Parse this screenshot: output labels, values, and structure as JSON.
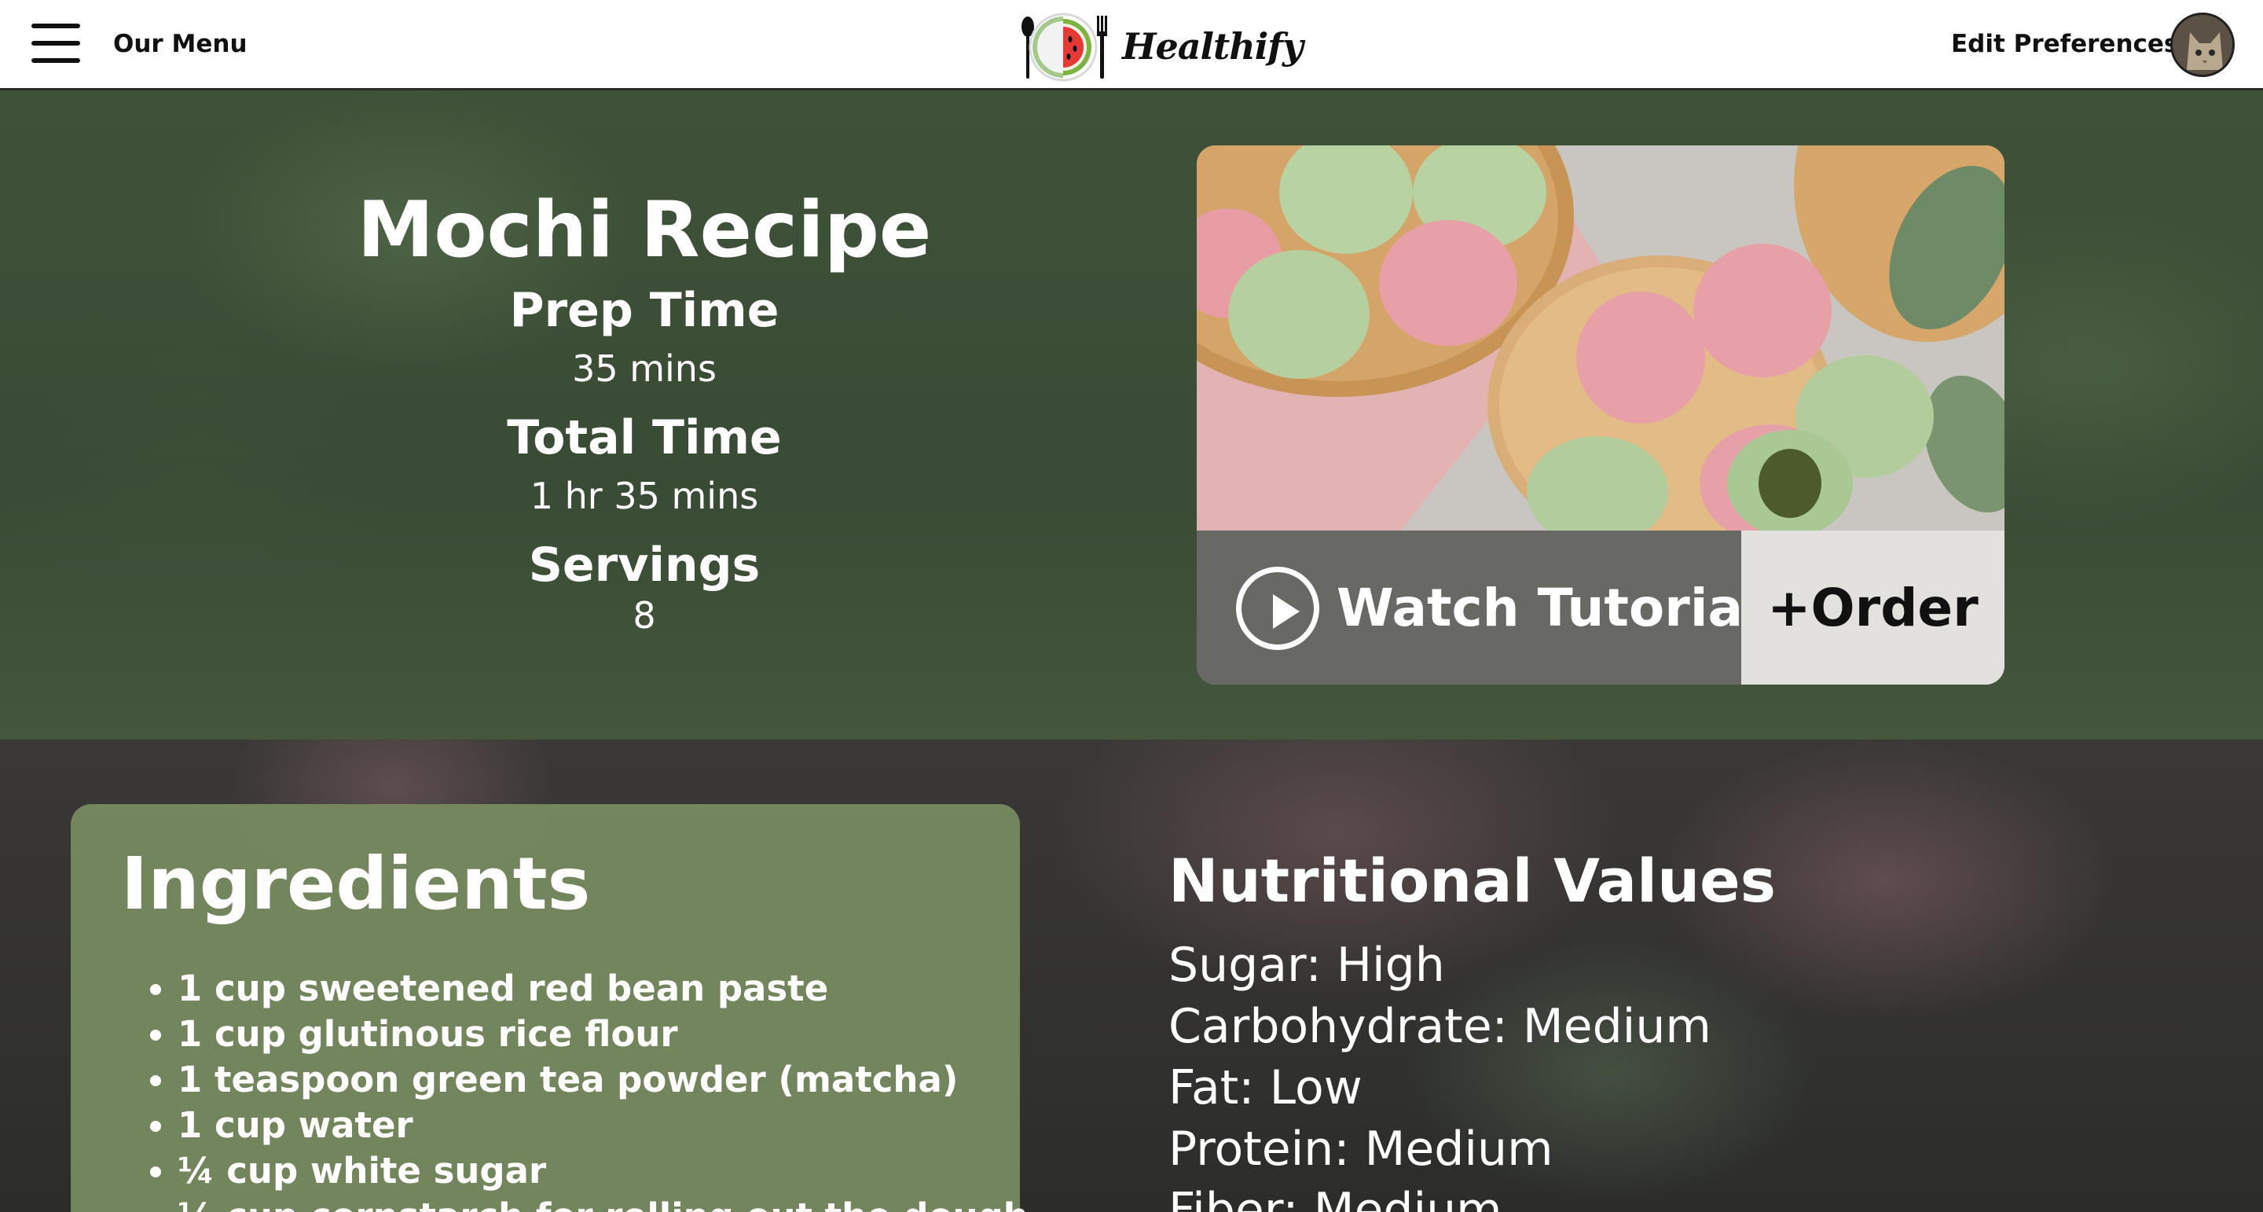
{
  "nav": {
    "menu_label": "Our Menu",
    "brand": "Healthify",
    "edit_preferences": "Edit Preferences"
  },
  "recipe": {
    "title": "Mochi Recipe",
    "prep_time_label": "Prep Time",
    "prep_time": "35 mins",
    "total_time_label": "Total Time",
    "total_time": "1 hr 35 mins",
    "servings_label": "Servings",
    "servings": "8"
  },
  "media": {
    "tutorial_label": "Watch Tutorial",
    "order_label": "+Order"
  },
  "ingredients": {
    "heading": "Ingredients",
    "items": [
      "1 cup sweetened red bean paste",
      "1 cup glutinous rice flour",
      "1 teaspoon green tea powder (matcha)",
      "1 cup water",
      "¼ cup white sugar",
      "½ cup cornstarch for rolling out the dough"
    ]
  },
  "nutrition": {
    "heading": "Nutritional Values",
    "items": [
      "Sugar: High",
      "Carbohydrate: Medium",
      "Fat: Low",
      "Protein: Medium",
      "Fiber: Medium"
    ]
  },
  "colors": {
    "hero_green": "#3f5239",
    "card_green": "#768a60",
    "order_bg": "#e3e1de",
    "tutorial_bg": "#5f5f5c"
  },
  "icons": [
    "hamburger-icon",
    "watermelon-plate-logo-icon",
    "avatar-cat-photo",
    "play-icon"
  ]
}
